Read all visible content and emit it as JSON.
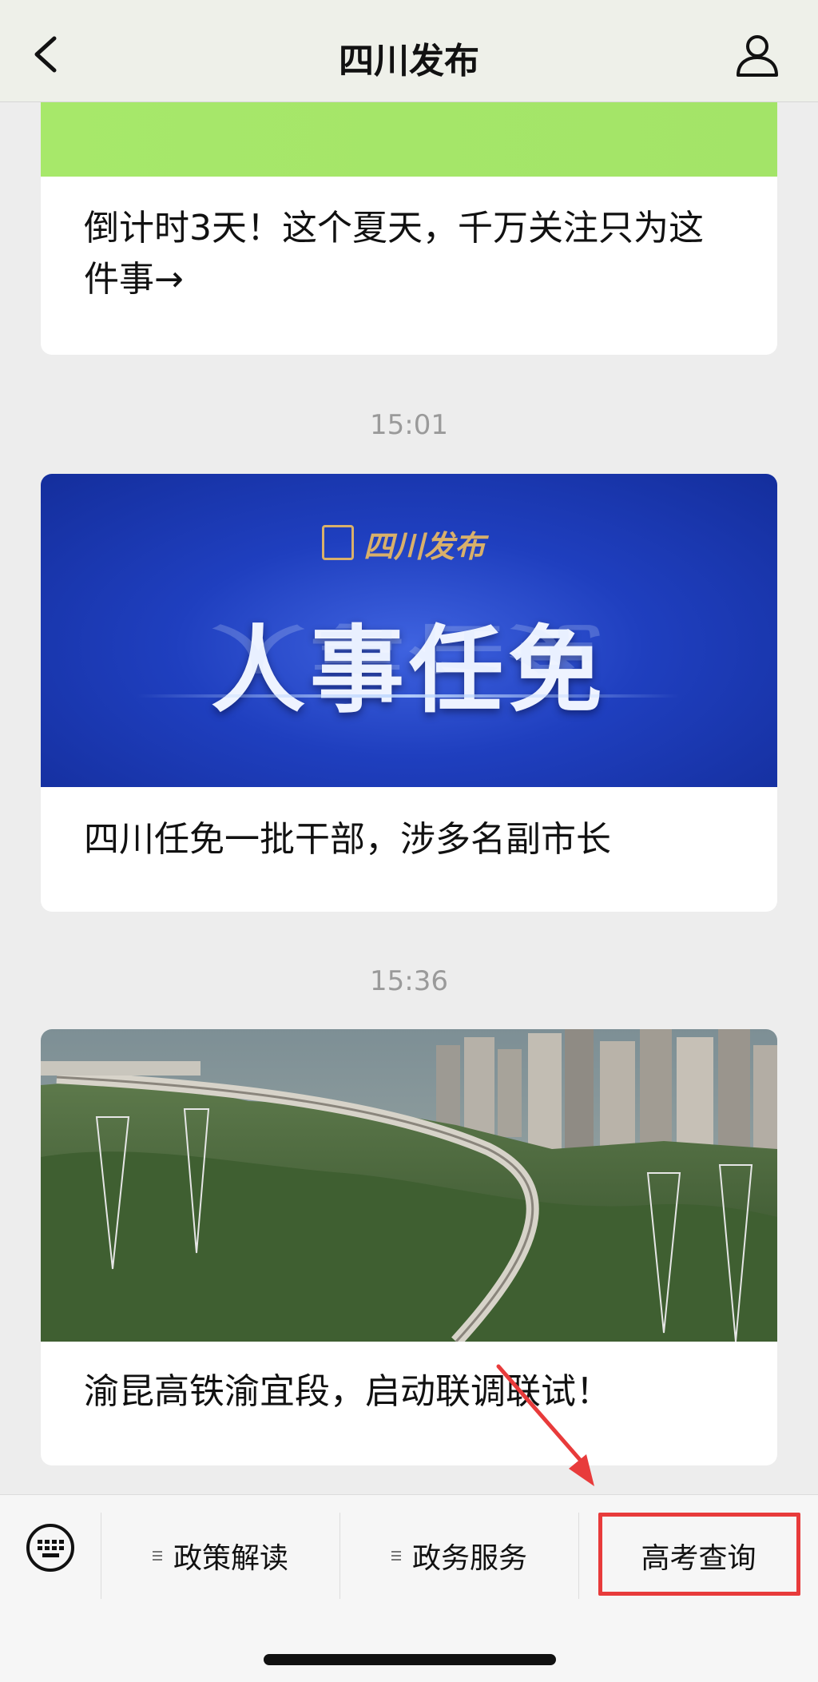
{
  "header": {
    "title": "四川发布",
    "back_icon": "chevron-left-icon",
    "profile_icon": "person-icon"
  },
  "feed": {
    "items": [
      {
        "caption": "倒计时3天！这个夏天，千万关注只为这件事→"
      },
      {
        "time": "15:01",
        "image_logo_text": "四川发布",
        "image_headline": "人事任免",
        "caption": "四川任免一批干部，涉多名副市长"
      },
      {
        "time": "15:36",
        "caption": "渝昆高铁渝宜段，启动联调联试！"
      }
    ]
  },
  "menu": {
    "keyboard_icon": "keyboard-icon",
    "items": [
      {
        "label": "政策解读"
      },
      {
        "label": "政务服务"
      },
      {
        "label": "高考查询"
      }
    ],
    "highlight_color": "#e83b3b"
  },
  "colors": {
    "nav_bg": "#eef0e9",
    "page_bg": "#ededed",
    "banner_green": "#a7e86a",
    "annotation_red": "#e83b3b"
  }
}
